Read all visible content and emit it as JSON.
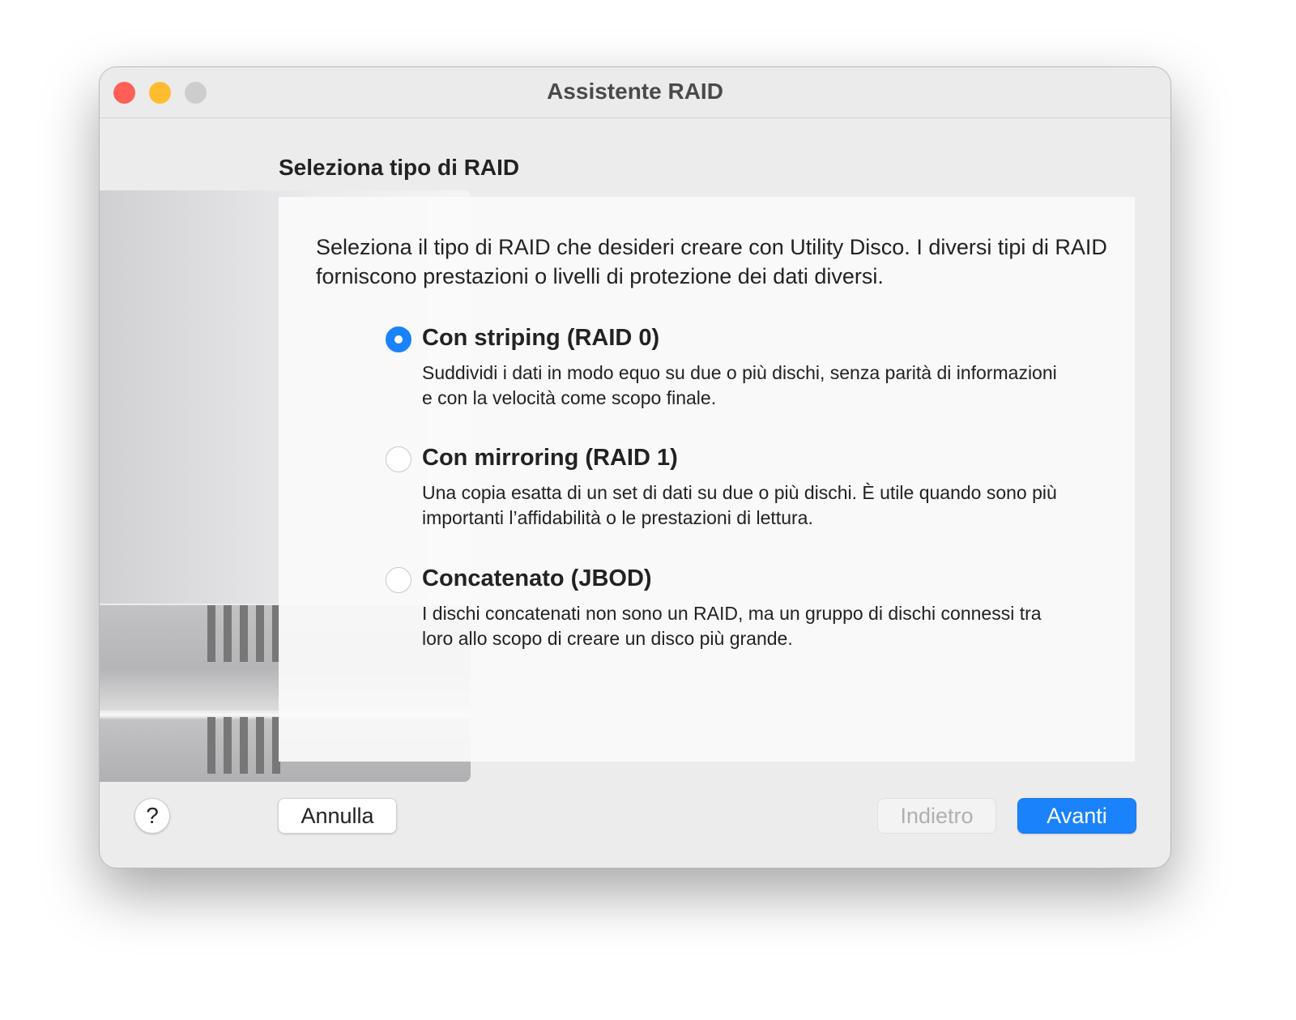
{
  "window": {
    "title": "Assistente RAID"
  },
  "heading": "Seleziona tipo di RAID",
  "intro": "Seleziona il tipo di RAID che desideri creare con Utility Disco. I diversi tipi di RAID forniscono prestazioni o livelli di protezione dei dati diversi.",
  "options": [
    {
      "title": "Con striping (RAID 0)",
      "description": "Suddividi i dati in modo equo su due o più dischi, senza parità di informazioni e con la velocità come scopo finale.",
      "selected": true
    },
    {
      "title": "Con mirroring (RAID 1)",
      "description": "Una copia esatta di un set di dati su due o più dischi. È utile quando sono più importanti l’affidabilità o le prestazioni di lettura.",
      "selected": false
    },
    {
      "title": "Concatenato (JBOD)",
      "description": "I dischi concatenati non sono un RAID, ma un gruppo di dischi connessi tra loro allo scopo di creare un disco più grande.",
      "selected": false
    }
  ],
  "buttons": {
    "help": "?",
    "cancel": "Annulla",
    "back": "Indietro",
    "next": "Avanti"
  },
  "colors": {
    "accent": "#1a82fb",
    "close": "#fe5f57",
    "minimize": "#febc2e",
    "zoom": "#cdcdcd"
  }
}
